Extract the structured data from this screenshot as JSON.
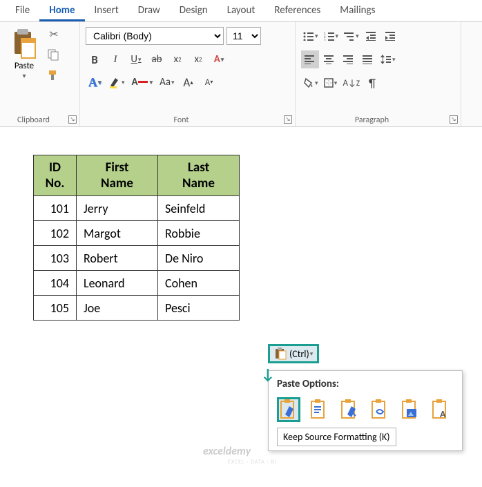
{
  "tabs": [
    "File",
    "Home",
    "Insert",
    "Draw",
    "Design",
    "Layout",
    "References",
    "Mailings"
  ],
  "active_tab": "Home",
  "groups": {
    "clipboard": {
      "label": "Clipboard",
      "paste": "Paste"
    },
    "font": {
      "label": "Font",
      "name": "Calibri (Body)",
      "size": "11",
      "bold": "B",
      "italic": "I",
      "underline": "U",
      "strike": "ab",
      "sub": "x",
      "sup": "x",
      "case": "Aa",
      "grow": "A",
      "shrink": "A"
    },
    "paragraph": {
      "label": "Paragraph"
    }
  },
  "table": {
    "headers": [
      "ID No.",
      "First Name",
      "Last Name"
    ],
    "rows": [
      {
        "id": "101",
        "first": "Jerry",
        "last": "Seinfeld"
      },
      {
        "id": "102",
        "first": "Margot",
        "last": "Robbie"
      },
      {
        "id": "103",
        "first": "Robert",
        "last": "De Niro"
      },
      {
        "id": "104",
        "first": "Leonard",
        "last": "Cohen"
      },
      {
        "id": "105",
        "first": "Joe",
        "last": "Pesci"
      }
    ]
  },
  "paste_options": {
    "ctrl": "(Ctrl)",
    "title": "Paste Options:",
    "tooltip": "Keep Source Formatting (K)"
  },
  "watermark": "exceldemy",
  "watermark_sub": "EXCEL · DATA · BI"
}
